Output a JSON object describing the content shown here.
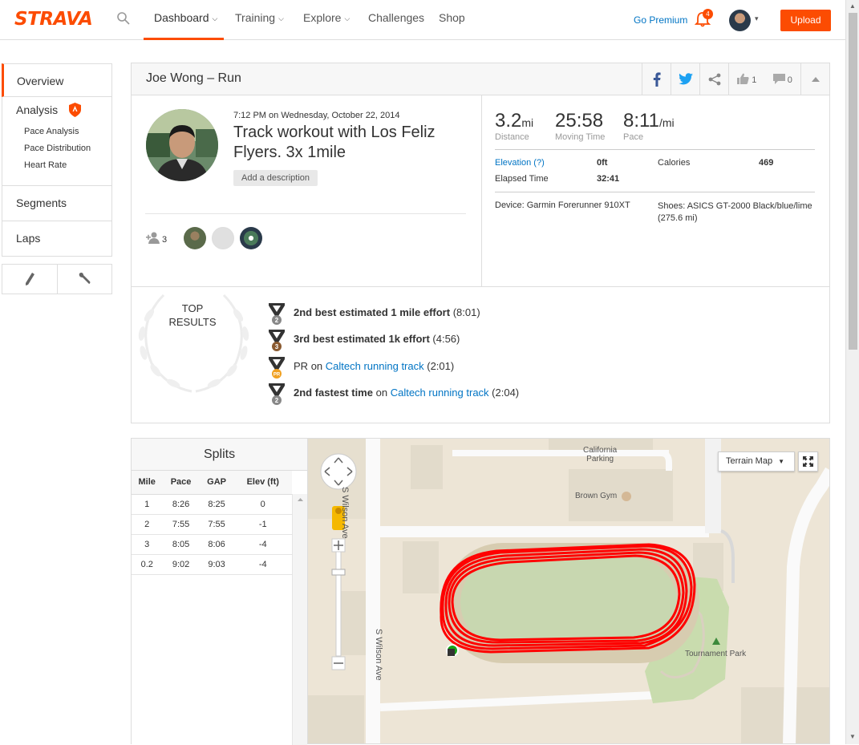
{
  "brand": {
    "logo_text": "STRAVA",
    "accent": "#fc4c02"
  },
  "nav": {
    "items": [
      {
        "label": "Dashboard",
        "has_caret": true
      },
      {
        "label": "Training",
        "has_caret": true
      },
      {
        "label": "Explore",
        "has_caret": true
      },
      {
        "label": "Challenges",
        "has_caret": false
      },
      {
        "label": "Shop",
        "has_caret": false
      }
    ],
    "go_premium": "Go Premium",
    "notification_count": "4",
    "upload_label": "Upload"
  },
  "sidebar": {
    "overview": "Overview",
    "analysis": "Analysis",
    "analysis_items": [
      "Pace Analysis",
      "Pace Distribution",
      "Heart Rate"
    ],
    "segments": "Segments",
    "laps": "Laps"
  },
  "activity": {
    "header_title": "Joe Wong – Run",
    "kudos_count": "1",
    "comment_count": "0",
    "date_time": "7:12 PM",
    "date_on": "on Wednesday, October 22, 2014",
    "name": "Track workout with Los Feliz Flyers. 3x 1mile",
    "add_description": "Add a description",
    "athlete_count": "3"
  },
  "stats": {
    "distance": {
      "value": "3.2",
      "unit": "mi",
      "label": "Distance"
    },
    "moving_time": {
      "value": "25:58",
      "label": "Moving Time"
    },
    "pace": {
      "value": "8:11",
      "unit": "/mi",
      "label": "Pace"
    },
    "elevation_label": "Elevation (?)",
    "elevation_value": "0ft",
    "calories_label": "Calories",
    "calories_value": "469",
    "elapsed_label": "Elapsed Time",
    "elapsed_value": "32:41",
    "device": "Device: Garmin Forerunner 910XT",
    "shoes_line1": "Shoes: ASICS GT-2000 Black/blue/lime",
    "shoes_line2": "(275.6 mi)"
  },
  "top_results": {
    "title_line1": "TOP",
    "title_line2": "RESULTS",
    "items": [
      {
        "medal": "2",
        "bold": "2nd best estimated 1 mile effort",
        "mid": "",
        "link": "",
        "tail": "(8:01)"
      },
      {
        "medal": "3",
        "bold": "3rd best estimated 1k effort",
        "mid": "",
        "link": "",
        "tail": "(4:56)"
      },
      {
        "medal": "PR",
        "bold": "",
        "lead": "PR",
        "mid": "on",
        "link": "Caltech running track",
        "tail": "(2:01)"
      },
      {
        "medal": "2",
        "bold": "2nd fastest time",
        "mid": "on",
        "link": "Caltech running track",
        "tail": "(2:04)"
      }
    ]
  },
  "splits": {
    "title": "Splits",
    "columns": [
      "Mile",
      "Pace",
      "GAP",
      "Elev (ft)"
    ],
    "rows": [
      [
        "1",
        "8:26",
        "8:25",
        "0"
      ],
      [
        "2",
        "7:55",
        "7:55",
        "-1"
      ],
      [
        "3",
        "8:05",
        "8:06",
        "-4"
      ],
      [
        "0.2",
        "9:02",
        "9:03",
        "-4"
      ]
    ]
  },
  "map": {
    "terrain_label": "Terrain Map",
    "labels": {
      "california_parking_1": "California",
      "california_parking_2": "Parking",
      "brown_gym": "Brown Gym",
      "tournament_park": "Tournament Park",
      "street_1": "S Wilson Ave",
      "street_2": "S Wilson Ave"
    },
    "route_color": "#ff0000"
  }
}
